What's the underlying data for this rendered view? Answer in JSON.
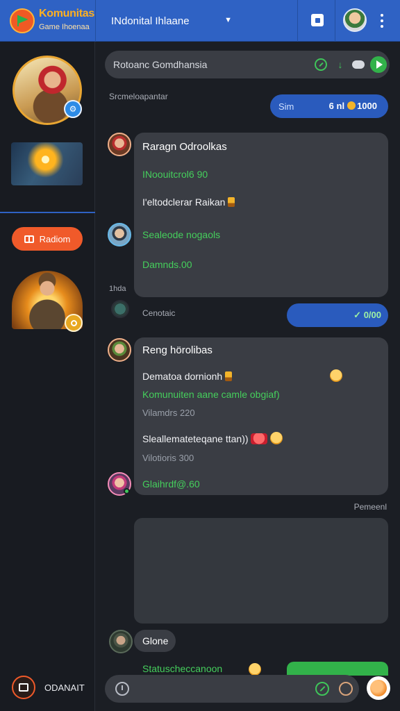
{
  "header": {
    "brand": "Komunitas",
    "subtitle": "Game Ihoenaa",
    "community_title": "INdonital Ihlaane"
  },
  "sidebar": {
    "button_label": "Radiom",
    "bottom_label": "ODANAIT"
  },
  "chat": {
    "search_title": "Rotoanc Gomdhansia",
    "section_label_1": "Srcmeloapantar",
    "pill_1": {
      "left": "Sim",
      "right": "6 nl",
      "coin_value": "1000"
    },
    "card_1": {
      "author": "Raragn Odroolkas",
      "line_1": "INoouitcrol6 90",
      "line_2": "I'eltodclerar Raikan",
      "line_3": "Sealeode nogaols",
      "line_4": "Damnds.00"
    },
    "side_time": "1hda",
    "section_label_2": "Cenotaic",
    "pill_2": {
      "right": "0/00"
    },
    "card_2": {
      "author": "Reng hörolibas",
      "line_1": "Dematoa dornionh",
      "line_2": "Komunuiten aane camle obgiaf)",
      "line_3": "Vilamdrs 220",
      "line_4": "Sleallemateteqane ttan))",
      "line_5": "Vilotioris 300",
      "line_6": "Glaihrdf@.60"
    },
    "right_label": "Pemeenl",
    "small_bubble": "Glone",
    "partial_line": "Statuscheccanoon"
  },
  "colors": {
    "header_blue": "#2f62c4",
    "accent_orange": "#f05a2a",
    "accent_green": "#45cf5c",
    "card_bg": "#3a3d44",
    "page_bg": "#1b1e24"
  },
  "icons": [
    "logo-flag-icon",
    "chevron-down-icon",
    "save-icon",
    "more-vertical-icon",
    "check-circle-icon",
    "download-icon",
    "cloud-icon",
    "send-icon",
    "book-icon",
    "clock-icon",
    "pen-icon",
    "cookie-icon",
    "emoji-icon"
  ]
}
